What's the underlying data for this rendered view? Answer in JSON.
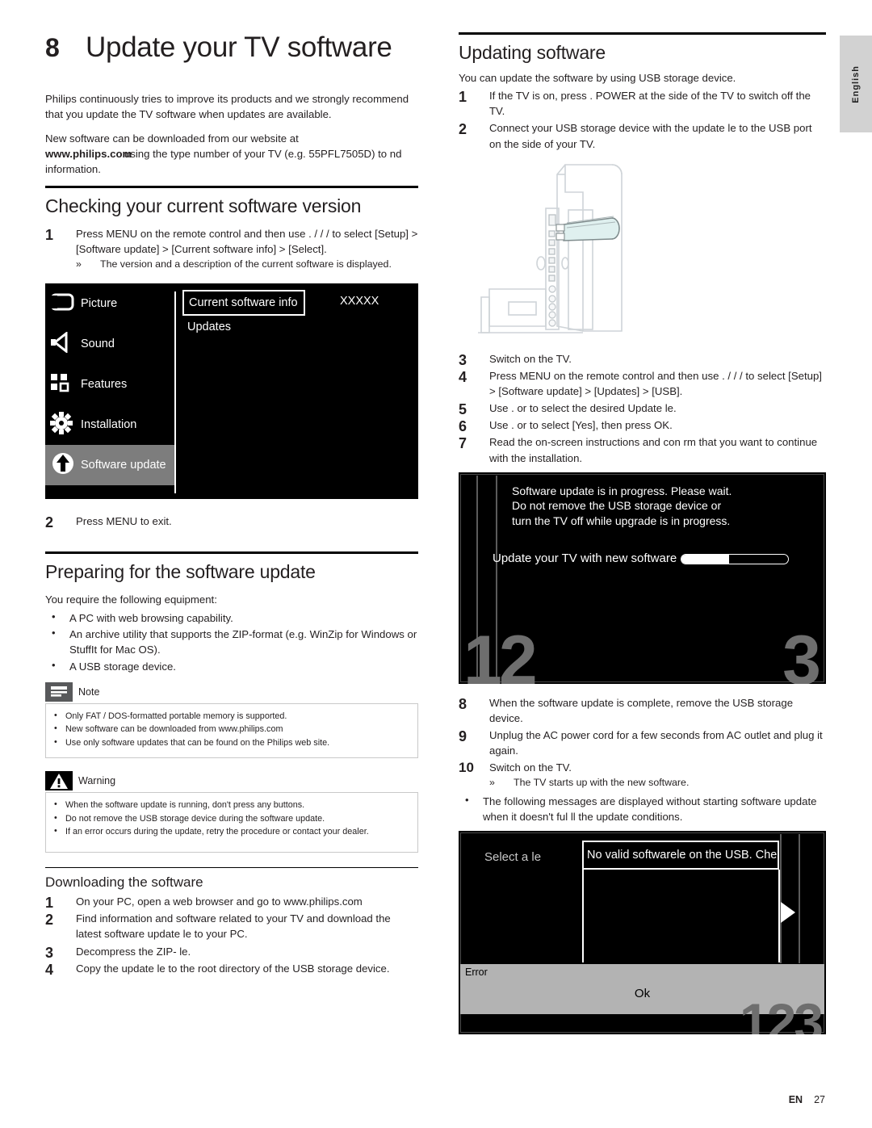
{
  "language_tab": "English",
  "footer": {
    "locale": "EN",
    "page": "27"
  },
  "chapter": {
    "number": "8",
    "title": "Update your TV software"
  },
  "intro": {
    "p1": "Philips continuously tries to improve its products and we strongly recommend that you update the TV software when updates are available.",
    "p2_a": "New software can be downloaded from our website at ",
    "p2_url": "www.philips.com",
    "p2_b": " using the type number of your TV (e.g. 55PFL7505D) to  nd information."
  },
  "checking": {
    "heading": "Checking your current software version",
    "step1": "Press MENU on the remote control and then use .  /  /  /   to select [Setup] > [Software update] > [Current software info] > [Select].",
    "step1_note": "The version and a description of the current software is displayed.",
    "step2": "Press MENU to exit."
  },
  "osd_menu": {
    "items": [
      {
        "label": "Picture",
        "icon": "picture-icon",
        "active": false
      },
      {
        "label": "Sound",
        "icon": "speaker-icon",
        "active": false
      },
      {
        "label": "Features",
        "icon": "features-icon",
        "active": false
      },
      {
        "label": "Installation",
        "icon": "gear-icon",
        "active": false
      },
      {
        "label": "Software update",
        "icon": "upload-arrow-icon",
        "active": true
      }
    ],
    "selected_row": "Current software info",
    "selected_value": "XXXXX",
    "second_row": "Updates"
  },
  "preparing": {
    "heading": "Preparing for the software update",
    "lead": "You require the following equipment:",
    "bullets": [
      "A PC with web browsing capability.",
      "An archive utility that supports the ZIP-format (e.g. WinZip for Windows or StuffIt for Mac OS).",
      "A USB storage device."
    ]
  },
  "note_box": {
    "title": "Note",
    "items": [
      "Only FAT / DOS-formatted portable memory is supported.",
      "New software can be downloaded from www.philips.com",
      "Use only software updates that can be found on the Philips web site."
    ]
  },
  "warning_box": {
    "title": "Warning",
    "items": [
      "When the software update is running, don't press any buttons.",
      "Do not remove the USB storage device during the software update.",
      "If an error occurs during the update, retry the procedure or contact your dealer."
    ]
  },
  "downloading": {
    "heading": "Downloading the software",
    "steps": [
      "On your PC, open a web browser and go to www.philips.com",
      "Find information and software related to your TV and download the latest software update  le to your PC.",
      "Decompress the ZIP- le.",
      "Copy the update  le to the root directory of the USB storage device."
    ]
  },
  "updating": {
    "heading": "Updating software",
    "lead": "You can update the software by using USB storage device.",
    "step1": "If the TV is on, press .    POWER at the side of the TV to switch off the TV.",
    "step2": "Connect your USB storage device with the update  le to the USB port on the side of your TV.",
    "step3": "Switch on the TV.",
    "step4": "Press MENU on the remote control and then use .  /  /  /   to select [Setup] > [Software update] > [Updates] > [USB].",
    "step5": "Use .  or   to select the desired Update  le.",
    "step6": "Use .  or   to select [Yes], then press OK.",
    "step7": "Read the on-screen instructions and con rm that you want to continue with the installation.",
    "step8": "When the software update is complete, remove the USB storage device.",
    "step9": "Unplug the AC power cord for a few seconds from AC outlet and plug it again.",
    "step10": "Switch on the TV.",
    "step10_note": "The TV starts up with the new software.",
    "final_bullet": "The following messages are displayed without starting software update when it doesn't ful ll the update conditions."
  },
  "osd_progress": {
    "line1": "Software update is in progress. Please wait.",
    "line2": "Do not remove the USB storage device or",
    "line3": "turn the TV off while upgrade is in progress.",
    "caption": "Update your TV with new software",
    "progress_percent": 45,
    "big_left": "12",
    "big_right": "3"
  },
  "osd_error": {
    "left_label": "Select  a le",
    "message": "No valid softwarele on the USB. Chec",
    "dialog_title": "Error",
    "ok_label": "Ok",
    "big_number": "123"
  }
}
